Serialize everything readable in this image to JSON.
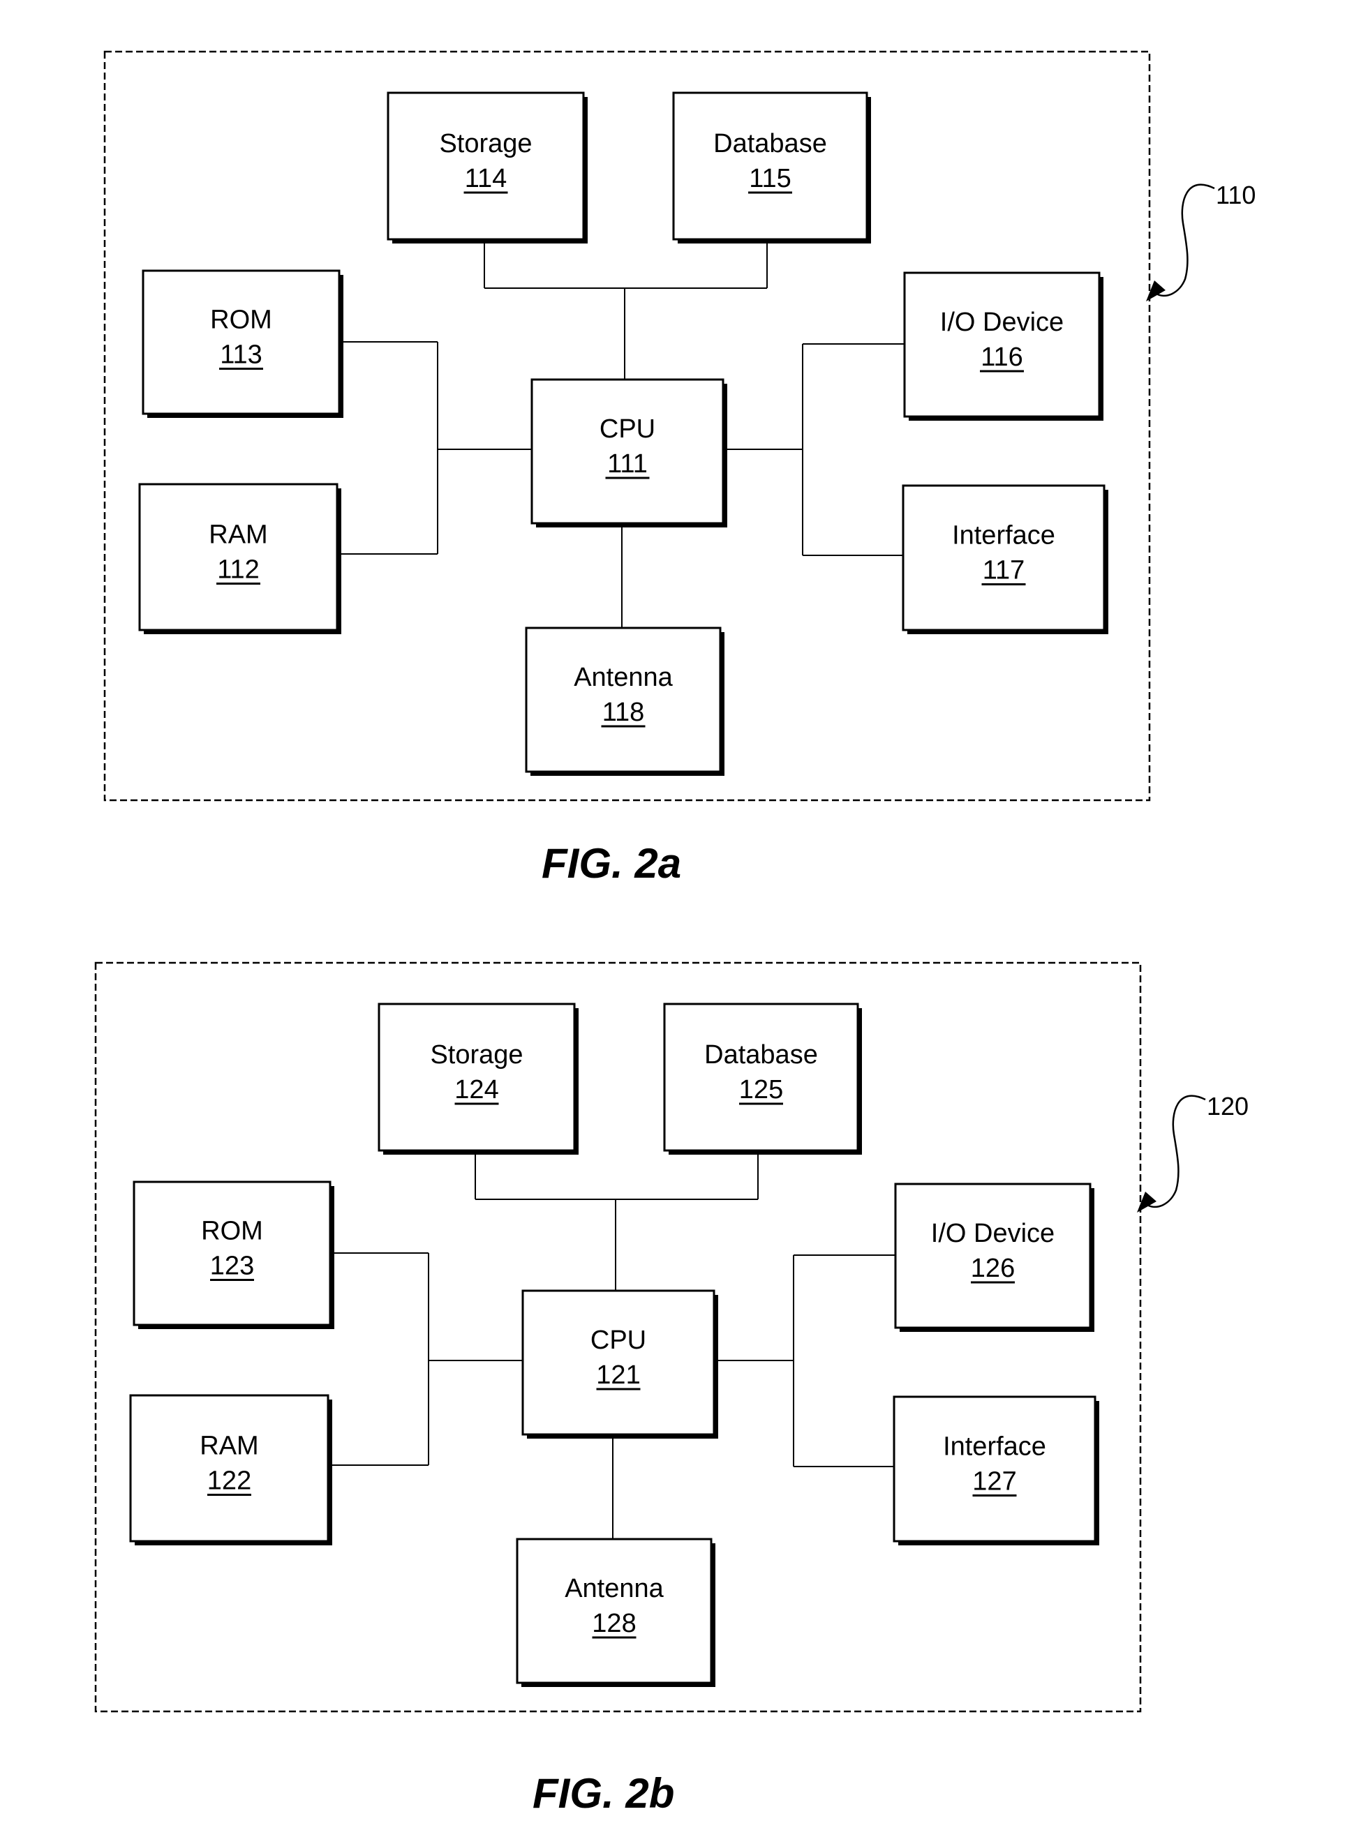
{
  "figures": [
    {
      "id": "fig2a",
      "caption": "FIG. 2a",
      "reference": "110",
      "blocks": {
        "cpu": {
          "name": "CPU",
          "ref": "111"
        },
        "ram": {
          "name": "RAM",
          "ref": "112"
        },
        "rom": {
          "name": "ROM",
          "ref": "113"
        },
        "storage": {
          "name": "Storage",
          "ref": "114"
        },
        "database": {
          "name": "Database",
          "ref": "115"
        },
        "io": {
          "name": "I/O Device",
          "ref": "116"
        },
        "interface": {
          "name": "Interface",
          "ref": "117"
        },
        "antenna": {
          "name": "Antenna",
          "ref": "118"
        }
      }
    },
    {
      "id": "fig2b",
      "caption": "FIG. 2b",
      "reference": "120",
      "blocks": {
        "cpu": {
          "name": "CPU",
          "ref": "121"
        },
        "ram": {
          "name": "RAM",
          "ref": "122"
        },
        "rom": {
          "name": "ROM",
          "ref": "123"
        },
        "storage": {
          "name": "Storage",
          "ref": "124"
        },
        "database": {
          "name": "Database",
          "ref": "125"
        },
        "io": {
          "name": "I/O Device",
          "ref": "126"
        },
        "interface": {
          "name": "Interface",
          "ref": "127"
        },
        "antenna": {
          "name": "Antenna",
          "ref": "128"
        }
      }
    }
  ],
  "connections": [
    [
      "storage",
      "cpu"
    ],
    [
      "database",
      "cpu"
    ],
    [
      "rom",
      "cpu"
    ],
    [
      "ram",
      "cpu"
    ],
    [
      "io",
      "cpu"
    ],
    [
      "interface",
      "cpu"
    ],
    [
      "antenna",
      "cpu"
    ]
  ]
}
